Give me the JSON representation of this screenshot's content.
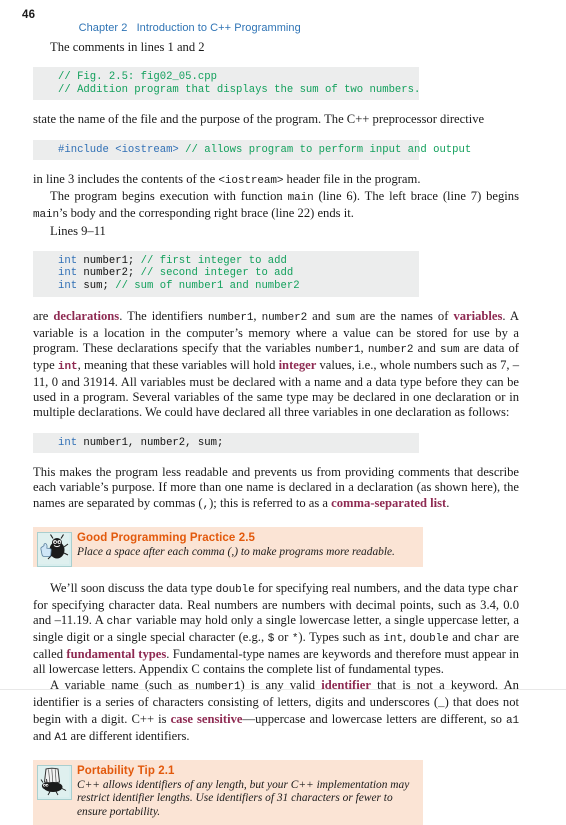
{
  "page": {
    "folio": "46",
    "running_head_chapter": "Chapter 2",
    "running_head_title": "Introduction to C++ Programming",
    "header_color": "#2f74b5",
    "code_bg": "#eceded",
    "tip_bg": "#fbe4d5",
    "tip_title_color": "#e2590c",
    "term_color": "#8e2a52",
    "comment_color": "#12a05c",
    "keyword_color": "#2f6fb5"
  },
  "paragraphs": {
    "p1": "The comments in lines 1 and 2",
    "p2_pre": "state the name of the file and the purpose of the program. The C++ preprocessor directive",
    "p3_a": "in line 3 includes the contents of the ",
    "p3_mono": "<iostream>",
    "p3_b": " header file in the program.",
    "p4_a": "The program begins execution with function ",
    "p4_mono1": "main",
    "p4_b": " (line 6). The left brace (line 7) begins ",
    "p4_mono2": "main",
    "p4_c": "’s body and the corresponding right brace (line 22) ends it.",
    "p5": "Lines 9–11",
    "p6_a": "are ",
    "p6_term1": "declarations",
    "p6_b": ". The identifiers ",
    "p6_m1": "number1",
    "p6_c": ", ",
    "p6_m2": "number2",
    "p6_d": " and ",
    "p6_m3": "sum",
    "p6_e": " are the names of ",
    "p6_term2": "variables",
    "p6_f": ". A variable is a location in the computer’s memory where a value can be stored for use by a program. These declarations specify that the variables ",
    "p6_g": " are data of type ",
    "p6_term3": "int",
    "p6_h": ", meaning that these variables will hold ",
    "p6_term4": "integer",
    "p6_i": " values, i.e., whole numbers such as 7, –11, 0 and 31914. All variables must be declared with a name and a data type before they can be used in a program. Several variables of the same type may be declared in one declaration or in multiple declarations. We could have declared all three variables in one declaration as follows:",
    "p7_a": "This makes the program less readable and prevents us from providing comments that describe each variable’s purpose. If more than one name is declared in a declaration (as shown here), the names are separated by commas (",
    "p7_mono": ",",
    "p7_b": "); this is referred to as a ",
    "p7_term": "comma-separated list",
    "p7_c": ".",
    "p8_a": "We’ll soon discuss the data type ",
    "p8_m1": "double",
    "p8_b": " for specifying real numbers, and the data type ",
    "p8_m2": "char",
    "p8_c": " for specifying character data. Real numbers are numbers with decimal points, such as 3.4, 0.0 and –11.19. A ",
    "p8_m3": "char",
    "p8_d": " variable may hold only a single lowercase letter, a single uppercase letter, a single digit or a single special character (e.g., ",
    "p8_m4": "$",
    "p8_e": " or ",
    "p8_m5": "*",
    "p8_f": "). Types such as ",
    "p8_m6": "int",
    "p8_g": ", ",
    "p8_m7": "double",
    "p8_h": " and ",
    "p8_m8": "char",
    "p8_i": " are called ",
    "p8_term": "fundamental types",
    "p8_j": ". Fundamental-type names are keywords and therefore must appear in all lowercase letters. Appendix C contains the complete list of fundamental types.",
    "p9_a": "A variable name (such as ",
    "p9_m1": "number1",
    "p9_b": ") is any valid ",
    "p9_term1": "identifier",
    "p9_c": " that is not a keyword. An identifier is a series of characters consisting of letters, digits and underscores (",
    "p9_m2": "_",
    "p9_d": ") that does not begin with a digit. C++ is ",
    "p9_term2": "case sensitive",
    "p9_e": "—uppercase and lowercase letters are different, so ",
    "p9_m3": "a1",
    "p9_f": " and ",
    "p9_m4": "A1",
    "p9_g": " are different identifiers."
  },
  "code_blocks": {
    "block1": {
      "lines": [
        {
          "comment": "// Fig. 2.5: fig02_05.cpp"
        },
        {
          "comment": "// Addition program that displays the sum of two numbers."
        }
      ]
    },
    "block2": {
      "lines": [
        {
          "pre": "#include <iostream>",
          "comment": " // allows program to perform input and output"
        }
      ]
    },
    "block3": {
      "lines": [
        {
          "kw": "int",
          "code": " number1; ",
          "comment": "// first integer to add"
        },
        {
          "kw": "int",
          "code": " number2; ",
          "comment": "// second integer to add"
        },
        {
          "kw": "int",
          "code": " sum; ",
          "comment": "// sum of number1 and number2"
        }
      ]
    },
    "block4": {
      "lines": [
        {
          "kw": "int",
          "code": " number1, number2, sum;",
          "comment": ""
        }
      ]
    }
  },
  "tips": [
    {
      "id": "good-programming-practice",
      "icon": "bug-thumbs-up-icon",
      "title": "Good Programming Practice 2.5",
      "body": "Place a space after each comma (,) to make programs more readable."
    },
    {
      "id": "portability-tip",
      "icon": "shoe-bug-icon",
      "title": "Portability Tip 2.1",
      "body": "C++ allows identifiers of any length, but your C++ implementation may restrict identifier lengths. Use identifiers of 31 characters or fewer to ensure portability."
    }
  ]
}
